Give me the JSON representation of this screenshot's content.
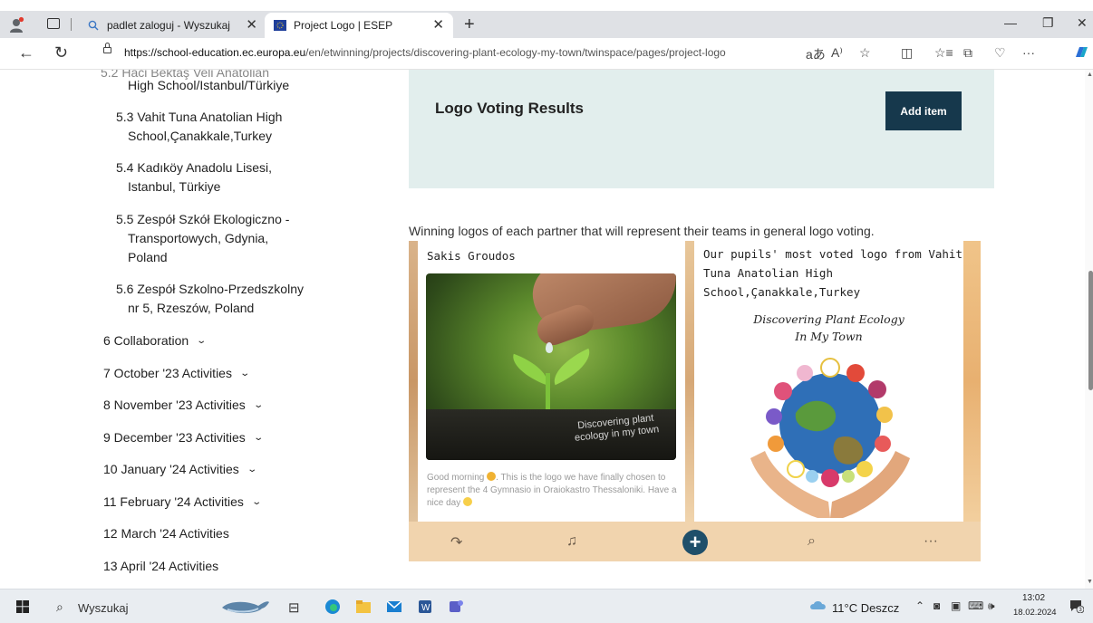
{
  "browser": {
    "tabs": [
      {
        "title": "padlet zaloguj - Wyszukaj",
        "active": false
      },
      {
        "title": "Project Logo | ESEP",
        "active": true
      }
    ],
    "url_host": "https://school-education.ec.europa.eu",
    "url_path": "/en/etwinning/projects/discovering-plant-ecology-my-town/twinspace/pages/project-logo",
    "aa_label": "aあ",
    "read_label": "A⁾"
  },
  "sidebar": {
    "items": [
      {
        "text": "High School/Istanbul/Türkiye"
      },
      {
        "number": "5.3",
        "lines": [
          "Vahit Tuna Anatolian High",
          "School,Çanakkale,Turkey"
        ]
      },
      {
        "number": "5.4",
        "lines": [
          "Kadıköy Anadolu Lisesi,",
          "Istanbul, Türkiye"
        ]
      },
      {
        "number": "5.5",
        "lines": [
          "Zespół Szkół Ekologiczno -",
          "Transportowych, Gdynia,",
          "Poland"
        ]
      },
      {
        "number": "5.6",
        "lines": [
          "Zespół Szkolno-Przedszkolny",
          "nr 5, Rzeszów, Poland"
        ]
      }
    ],
    "sections": [
      {
        "label": "6 Collaboration",
        "expandable": true
      },
      {
        "label": "7 October '23 Activities",
        "expandable": true
      },
      {
        "label": "8 November '23 Activities",
        "expandable": true
      },
      {
        "label": "9 December '23 Activities",
        "expandable": true
      },
      {
        "label": "10 January '24 Activities",
        "expandable": true
      },
      {
        "label": "11 February '24 Activities",
        "expandable": true
      },
      {
        "label": "12 March '24 Activities",
        "expandable": false
      },
      {
        "label": "13 April '24 Activities",
        "expandable": false
      }
    ]
  },
  "main": {
    "panel_title": "Logo Voting Results",
    "add_item_label": "Add item",
    "intro": "Winning logos of each partner that will represent their teams in general logo voting."
  },
  "padlet": {
    "card1": {
      "title": "Sakis Groudos",
      "photo_caption": "Discovering plant ecology in my town",
      "body_part1": "Good morning",
      "body_part2": ". This is the logo we have finally chosen to represent the 4 Gymnasio in Oraiokastro Thessaloniki. Have a nice day"
    },
    "card2": {
      "title_lines": [
        "Our pupils' most voted logo from Vahit",
        "Tuna Anatolian High",
        "School,Çanakkale,Turkey"
      ],
      "logo_text_lines": [
        "Discovering Plant Ecology",
        "In My Town"
      ]
    }
  },
  "taskbar": {
    "search_label": "Wyszukaj",
    "weather": "11°C  Deszcz",
    "time": "13:02",
    "date": "18.02.2024",
    "notification_count": "3"
  },
  "colors": {
    "panel_bg": "#e2eeed",
    "add_item_bg": "#16384c",
    "padlet_toolbar": "#f1d4ae",
    "padlet_add": "#1f4f6a"
  }
}
